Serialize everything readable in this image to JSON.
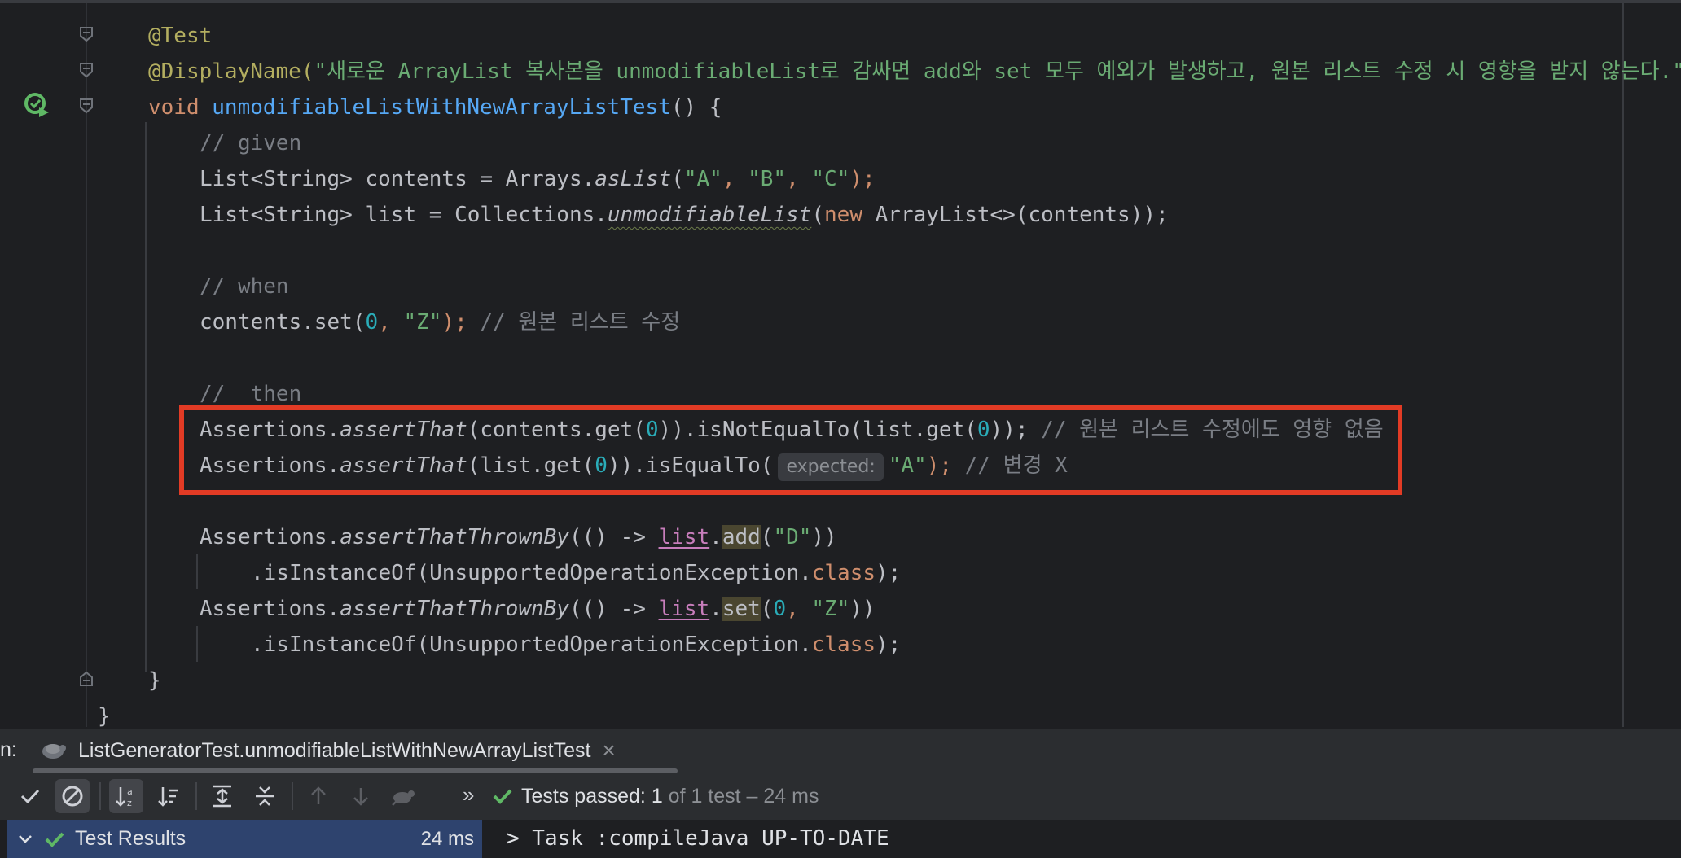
{
  "editor": {
    "lines": {
      "l1_ann": "@Test",
      "l2_ann": "@DisplayName(",
      "l2_str": "\"새로운 ArrayList 복사본을 unmodifiableList로 감싸면 add와 set 모두 예외가 발생하고, 원본 리스트 수정 시 영향을 받지 않는다.\"",
      "l2_close": ")",
      "l3_kw": "void ",
      "l3_fn": "unmodifiableListWithNewArrayListTest",
      "l3_rest": "() {",
      "l4_cmt": "// given",
      "l5_a": "List<String> contents = Arrays.",
      "l5_b": "asList",
      "l5_c": "(",
      "l5_s1": "\"A\"",
      "l5_sep1": ", ",
      "l5_s2": "\"B\"",
      "l5_sep2": ", ",
      "l5_s3": "\"C\"",
      "l5_end": ");",
      "l6_a": "List<String> list = Collections.",
      "l6_b": "unmodifiableList",
      "l6_c": "(",
      "l6_kw": "new ",
      "l6_d": "ArrayList<>(contents));",
      "l7_cmt": "// when",
      "l8_a": "contents.set(",
      "l8_num": "0",
      "l8_sep": ", ",
      "l8_str": "\"Z\"",
      "l8_end": "); ",
      "l8_cmt": "// 원본 리스트 수정",
      "l9_cmt": "//  then",
      "l10_a": "Assertions.",
      "l10_b": "assertThat",
      "l10_c": "(contents.get(",
      "l10_num1": "0",
      "l10_d": ")).isNotEqualTo(list.get(",
      "l10_num2": "0",
      "l10_e": ")); ",
      "l10_cmt": "// 원본 리스트 수정에도 영향 없음",
      "l11_a": "Assertions.",
      "l11_b": "assertThat",
      "l11_c": "(list.get(",
      "l11_num": "0",
      "l11_d": ")).isEqualTo(",
      "l11_hint": "expected:",
      "l11_str": "\"A\"",
      "l11_e": "); ",
      "l11_cmt": "// 변경 X",
      "l12_a": "Assertions.",
      "l12_b": "assertThatThrownBy",
      "l12_c": "(() -> ",
      "l12_list": "list",
      "l12_dot": ".",
      "l12_method": "add",
      "l12_d": "(",
      "l12_str": "\"D\"",
      "l12_e": "))",
      "l13_a": ".isInstanceOf(UnsupportedOperationException.",
      "l13_kw": "class",
      "l13_e": ");",
      "l14_a": "Assertions.",
      "l14_b": "assertThatThrownBy",
      "l14_c": "(() -> ",
      "l14_list": "list",
      "l14_dot": ".",
      "l14_method": "set",
      "l14_d": "(",
      "l14_num": "0",
      "l14_sep": ", ",
      "l14_str": "\"Z\"",
      "l14_e": "))",
      "l15_a": ".isInstanceOf(UnsupportedOperationException.",
      "l15_kw": "class",
      "l15_e": ");",
      "l16": "}",
      "l17": "}"
    }
  },
  "run_panel": {
    "label": "n:",
    "tab_title": "ListGeneratorTest.unmodifiableListWithNewArrayListTest",
    "tab_close": "×",
    "more": "»",
    "status_prefix": "Tests passed: ",
    "status_count": "1",
    "status_suffix": " of 1 test – 24 ms",
    "tree_item": "Test Results",
    "tree_duration": "24 ms",
    "console_line": "> Task :compileJava UP-TO-DATE"
  },
  "colors": {
    "highlight_border": "#e23b25",
    "pass_green": "#5fb865"
  },
  "icons": [
    "fold-icon",
    "run-test-icon",
    "check-icon",
    "stop-icon",
    "sort-alpha-icon",
    "sort-duration-icon",
    "expand-all-icon",
    "collapse-all-icon",
    "arrow-up-icon",
    "arrow-down-icon",
    "rerun-failed-icon",
    "test-tab-icon",
    "close-icon",
    "chevron-down-icon"
  ]
}
